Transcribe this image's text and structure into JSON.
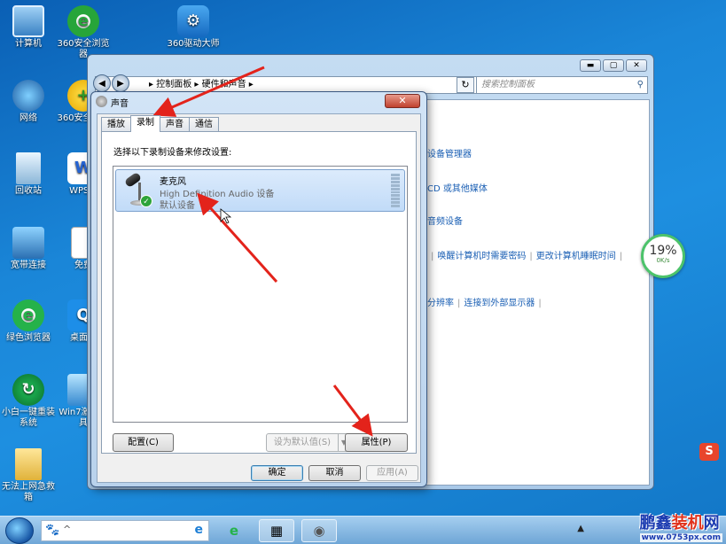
{
  "desktop": {
    "icons": [
      {
        "label": "计算机",
        "icon": "computer-icon"
      },
      {
        "label": "360安全浏览器",
        "icon": "360-browser-icon"
      },
      {
        "label": "360驱动大师",
        "icon": "driver-master-icon"
      },
      {
        "label": "网络",
        "icon": "network-icon"
      },
      {
        "label": "360安全卫士",
        "icon": "360-safe-icon"
      },
      {
        "label": "回收站",
        "icon": "recycle-bin-icon"
      },
      {
        "label": "WPS 2",
        "icon": "wps-icon"
      },
      {
        "label": "宽带连接",
        "icon": "broadband-icon"
      },
      {
        "label": "免费",
        "icon": "document-icon"
      },
      {
        "label": "绿色浏览器",
        "icon": "green-browser-icon"
      },
      {
        "label": "桌面搜",
        "icon": "desktop-search-icon"
      },
      {
        "label": "小白一键重装系统",
        "icon": "reinstall-icon"
      },
      {
        "label": "Win7激活工具",
        "icon": "win7-tool-icon"
      },
      {
        "label": "无法上网急救箱",
        "icon": "folder-icon"
      }
    ]
  },
  "control_panel": {
    "breadcrumb": [
      "控制面板",
      "硬件和声音"
    ],
    "search_placeholder": "搜索控制面板",
    "links": {
      "device_manager": "设备管理器",
      "cd_media": "CD 或其他媒体",
      "audio_devices": "音频设备",
      "wake_password": "唤醒计算机时需要密码",
      "sleep_time": "更改计算机睡眠时间",
      "resolution": "分辨率",
      "external_display": "连接到外部显示器"
    }
  },
  "gauge": {
    "percent": "19%",
    "speed": "0K/s",
    "value": 19
  },
  "sound_dialog": {
    "title": "声音",
    "close": "✕",
    "tabs": [
      "播放",
      "录制",
      "声音",
      "通信"
    ],
    "active_tab": 1,
    "instruction": "选择以下录制设备来修改设置:",
    "device": {
      "name": "麦克风",
      "description": "High Definition Audio 设备",
      "status": "默认设备"
    },
    "buttons": {
      "configure": "配置(C)",
      "set_default": "设为默认值(S)",
      "properties": "属性(P)",
      "ok": "确定",
      "cancel": "取消",
      "apply": "应用(A)"
    }
  },
  "taskbar": {
    "search_paw": "🐾",
    "tray_text": "▲"
  },
  "watermark": {
    "brand_left": "鹏鑫",
    "brand_mid": "装机",
    "brand_right": "网",
    "url": "www.0753px.com"
  },
  "colors": {
    "arrow": "#e3231b",
    "link": "#1a5fb4",
    "selection": "#c1dbf8"
  }
}
